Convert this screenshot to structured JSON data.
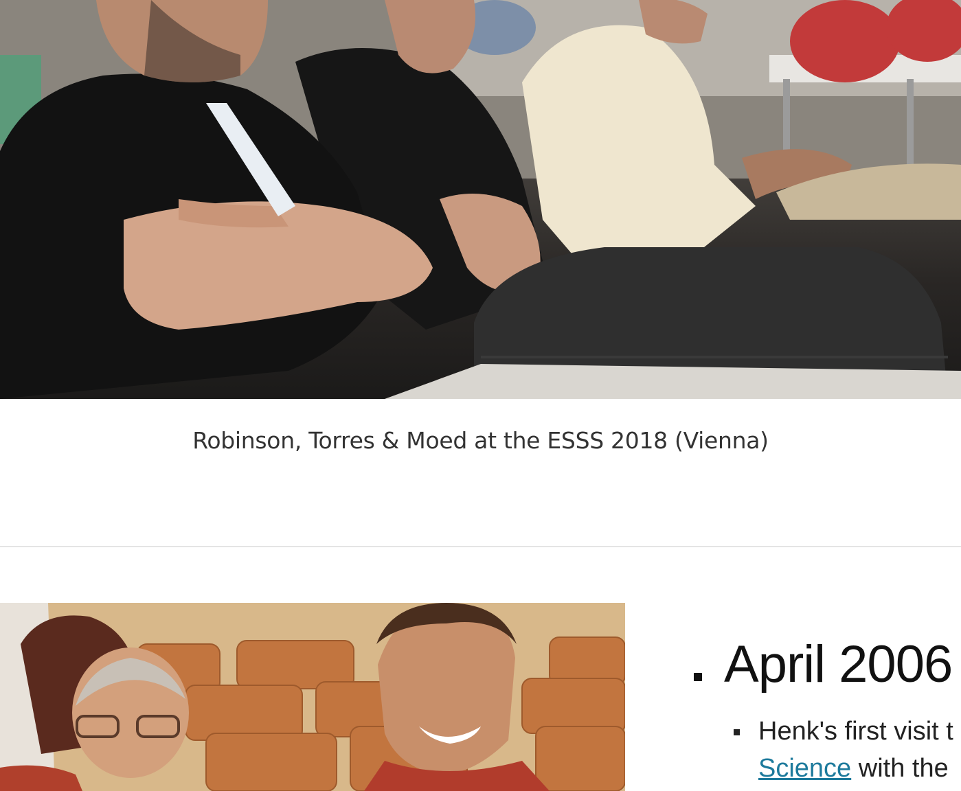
{
  "photos": [
    {
      "caption": "Robinson, Torres & Moed at the ESSS 2018 (Vienna)"
    },
    {
      "caption": ""
    }
  ],
  "timeline": {
    "heading": "April 2006",
    "items": [
      {
        "text_start": "Henk's first visit t",
        "link_text": "Science",
        "text_after_link": " with the"
      }
    ]
  },
  "colors": {
    "link": "#1d7a9c",
    "caption_text": "#333333",
    "divider": "#e4e4e4"
  }
}
